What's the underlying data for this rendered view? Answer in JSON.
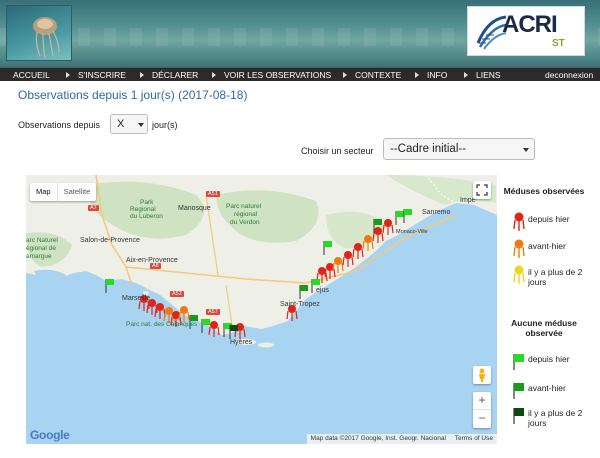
{
  "nav": {
    "items": [
      "ACCUEIL",
      "S'INSCRIRE",
      "DÉCLARER",
      "VOIR LES OBSERVATIONS",
      "CONTEXTE",
      "INFO",
      "LIENS"
    ],
    "logout": "deconnexion"
  },
  "brand": {
    "logo_text": "ACRI",
    "logo_sub": "ST"
  },
  "page": {
    "title": "Observations depuis 1 jour(s) (2017-08-18)",
    "obs_label": "Observations depuis",
    "days_value": "X",
    "days_suffix": "jour(s)",
    "sector_label": "Choisir un secteur",
    "sector_value": "--Cadre initial--"
  },
  "map": {
    "type_map": "Map",
    "type_satellite": "Satellite",
    "zoom_in": "+",
    "zoom_out": "−",
    "google": "Google",
    "attribution": "Map data ©2017 Google, Inst. Geogr. Nacional",
    "terms": "Terms of Use",
    "labels": {
      "park": "Park",
      "regional": "Regional",
      "luberon": "du Luberon",
      "manosque": "Manosque",
      "pnr_verdon_1": "Parc naturel",
      "pnr_verdon_2": "régional",
      "pnr_verdon_3": "du Verdon",
      "sanremo": "Sanremo",
      "imperia": "Impe",
      "salon": "Salon-de-Provence",
      "aix": "Aix-en-Provence",
      "pnr_camargue_1": "arc Naturel",
      "pnr_camargue_2": "égional de",
      "pnr_camargue_3": "amargue",
      "marseille": "Marseille",
      "calanques": "Parc nat. des Calanques",
      "monaco": "Monaco-Ville",
      "st_tropez": "Saint-Tropez",
      "frejus": "ejus",
      "hyeres": "Hyères",
      "road_a7": "A7",
      "road_a51": "A51",
      "road_a8": "A8",
      "road_a52": "A52",
      "road_a57": "A57"
    }
  },
  "legend": {
    "jelly_title": "Méduses observées",
    "jelly_items": [
      "depuis hier",
      "avant-hier",
      "il y a plus de 2 jours"
    ],
    "none_title": "Aucune méduse observée",
    "none_items": [
      "depuis hier",
      "avant-hier",
      "il y a plus de 2 jours"
    ],
    "colors": {
      "jelly_recent": "#e02418",
      "jelly_day_before": "#f07a10",
      "jelly_older": "#e8d820",
      "flag_recent": "#22dd22",
      "flag_day_before": "#169c16",
      "flag_older": "#0e4a0e"
    }
  }
}
